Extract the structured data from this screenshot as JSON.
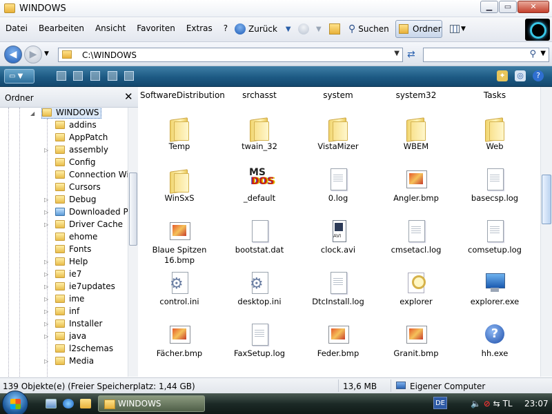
{
  "window": {
    "title": "WINDOWS",
    "minimize_glyph": "▁",
    "maximize_glyph": "▭",
    "close_glyph": "✕"
  },
  "menu": [
    "Datei",
    "Bearbeiten",
    "Ansicht",
    "Favoriten",
    "Extras",
    "?"
  ],
  "toolbar": {
    "back_label": "Zurück",
    "search_label": "Suchen",
    "folders_label": "Ordner"
  },
  "address": {
    "path": "C:\\WINDOWS",
    "search_placeholder": ""
  },
  "left_pane": {
    "title": "Ordner",
    "close_glyph": "✕",
    "root": "WINDOWS",
    "items": [
      "addins",
      "AppPatch",
      "assembly",
      "Config",
      "Connection Wiz",
      "Cursors",
      "Debug",
      "Downloaded Pro",
      "Driver Cache",
      "ehome",
      "Fonts",
      "Help",
      "ie7",
      "ie7updates",
      "ime",
      "inf",
      "Installer",
      "java",
      "l2schemas",
      "Media"
    ]
  },
  "content": {
    "header_row": [
      "SoftwareDistribution",
      "srchasst",
      "system",
      "system32",
      "Tasks"
    ],
    "rows": [
      [
        {
          "name": "Temp",
          "icon": "folder"
        },
        {
          "name": "twain_32",
          "icon": "folder"
        },
        {
          "name": "VistaMizer",
          "icon": "folder"
        },
        {
          "name": "WBEM",
          "icon": "folder"
        },
        {
          "name": "Web",
          "icon": "folder"
        }
      ],
      [
        {
          "name": "WinSxS",
          "icon": "folder"
        },
        {
          "name": "_default",
          "icon": "ms-dos"
        },
        {
          "name": "0.log",
          "icon": "text-doc"
        },
        {
          "name": "Angler.bmp",
          "icon": "bitmap"
        },
        {
          "name": "basecsp.log",
          "icon": "text-doc"
        }
      ],
      [
        {
          "name": "Blaue Spitzen 16.bmp",
          "icon": "bitmap"
        },
        {
          "name": "bootstat.dat",
          "icon": "blank-doc"
        },
        {
          "name": "clock.avi",
          "icon": "video"
        },
        {
          "name": "cmsetacl.log",
          "icon": "text-doc"
        },
        {
          "name": "comsetup.log",
          "icon": "text-doc"
        }
      ],
      [
        {
          "name": "control.ini",
          "icon": "settings-doc"
        },
        {
          "name": "desktop.ini",
          "icon": "settings-doc"
        },
        {
          "name": "DtcInstall.log",
          "icon": "text-doc"
        },
        {
          "name": "explorer",
          "icon": "explorer"
        },
        {
          "name": "explorer.exe",
          "icon": "computer"
        }
      ],
      [
        {
          "name": "Fächer.bmp",
          "icon": "bitmap"
        },
        {
          "name": "FaxSetup.log",
          "icon": "text-doc"
        },
        {
          "name": "Feder.bmp",
          "icon": "bitmap"
        },
        {
          "name": "Granit.bmp",
          "icon": "bitmap"
        },
        {
          "name": "hh.exe",
          "icon": "help"
        }
      ]
    ]
  },
  "status": {
    "objects": "139 Objekte(e) (Freier Speicherplatz: 1,44 GB)",
    "size": "13,6 MB",
    "location": "Eigener Computer"
  },
  "taskbar": {
    "window_button": "WINDOWS",
    "language": "DE",
    "tray_text": "TL",
    "clock": "23:07"
  }
}
